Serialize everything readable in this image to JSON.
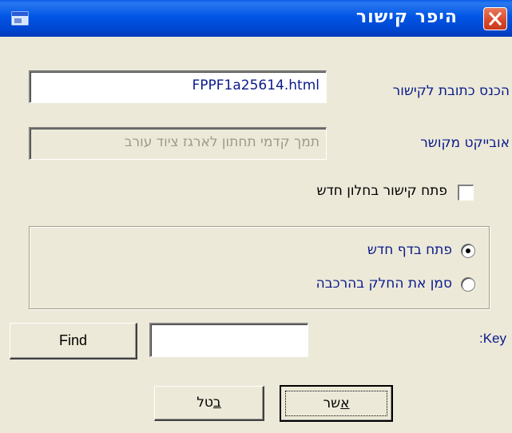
{
  "window": {
    "title": "היפר קישור",
    "icon": "app-window-icon",
    "close_icon": "close-x-icon"
  },
  "url_label": "הכנס כתובת לקישור",
  "url_value": "FPPF1a25614.html",
  "object_label": "אובייקט מקושר",
  "object_value": "תמך קדמי תחתון לארגז ציוד עורב",
  "new_window_checkbox": {
    "label": "פתח קישור בחלון חדש",
    "checked": false
  },
  "radio_options": [
    {
      "label": "פתח בדף חדש",
      "selected": true
    },
    {
      "label": "סמן את החלק בהרכבה",
      "selected": false
    }
  ],
  "key_label": ":Key",
  "key_value": "",
  "buttons": {
    "find": "Find",
    "cancel_u": "ב",
    "cancel_rest": "טל",
    "ok_u": "א",
    "ok_rest": "שר"
  },
  "colors": {
    "titlebar": "#0055e5",
    "dialog_bg": "#ece9d8",
    "label_text": "#0a1a8c",
    "close_button": "#d8482a"
  }
}
